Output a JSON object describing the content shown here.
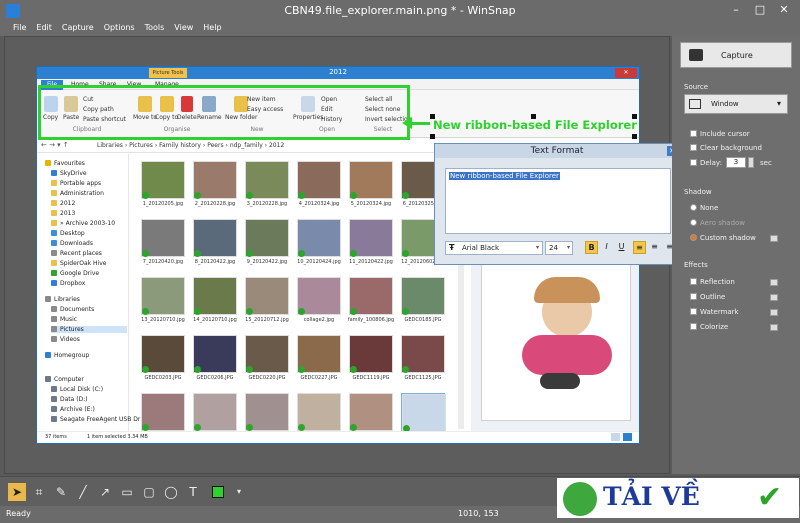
{
  "app": {
    "title": "CBN49.file_explorer.main.png * - WinSnap",
    "window_buttons": [
      "–",
      "□",
      "✕"
    ],
    "menu": [
      "File",
      "Edit",
      "Capture",
      "Options",
      "Tools",
      "View",
      "Help"
    ]
  },
  "explorer": {
    "title": "2012",
    "context_tab": "Picture Tools",
    "tabs": [
      "File",
      "Home",
      "Share",
      "View",
      "Manage"
    ],
    "ribbon": {
      "clipboard": {
        "copy": "Copy",
        "paste": "Paste",
        "cut": "Cut",
        "copy_path": "Copy path",
        "paste_shortcut": "Paste shortcut",
        "label": "Clipboard"
      },
      "organise": {
        "move_to": "Move to",
        "copy_to": "Copy to",
        "delete": "Delete",
        "rename": "Rename",
        "label": "Organise"
      },
      "new": {
        "new_folder": "New folder",
        "new_item": "New item",
        "easy_access": "Easy access",
        "label": "New"
      },
      "open": {
        "properties": "Properties",
        "open": "Open",
        "edit": "Edit",
        "history": "History",
        "label": "Open"
      },
      "select": {
        "select_all": "Select all",
        "select_none": "Select none",
        "invert": "Invert selection",
        "label": "Select"
      }
    },
    "breadcrumb": [
      "Libraries",
      "Pictures",
      "Family history",
      "Peers",
      "ndp_family",
      "2012"
    ],
    "nav": [
      {
        "label": "Favourites",
        "color": "#e6b400"
      },
      {
        "label": "SkyDrive",
        "color": "#2f7ed8"
      },
      {
        "label": "Portable apps",
        "color": "#e8c04a"
      },
      {
        "label": "Administration",
        "color": "#e8c04a"
      },
      {
        "label": "2012",
        "color": "#e8c04a"
      },
      {
        "label": "2013",
        "color": "#e8c04a"
      },
      {
        "label": "» Archive 2003-10",
        "color": "#e8c04a"
      },
      {
        "label": "Desktop",
        "color": "#3a8fd8"
      },
      {
        "label": "Downloads",
        "color": "#3a8fd8"
      },
      {
        "label": "Recent places",
        "color": "#8a8a8a"
      },
      {
        "label": "SpiderOak Hive",
        "color": "#e8c04a"
      },
      {
        "label": "Google Drive",
        "color": "#2da52d"
      },
      {
        "label": "Dropbox",
        "color": "#2f7ed8"
      },
      {
        "label": "Libraries",
        "color": "#8a8a8a"
      },
      {
        "label": "Documents",
        "color": "#8a8a8a"
      },
      {
        "label": "Music",
        "color": "#8a8a8a"
      },
      {
        "label": "Pictures",
        "color": "#8a8a8a"
      },
      {
        "label": "Videos",
        "color": "#8a8a8a"
      },
      {
        "label": "Homegroup",
        "color": "#2f7ed8"
      },
      {
        "label": "Computer",
        "color": "#6a7a8a"
      },
      {
        "label": "Local Disk (C:)",
        "color": "#6a7a8a"
      },
      {
        "label": "Data (D:)",
        "color": "#6a7a8a"
      },
      {
        "label": "Archive (E:)",
        "color": "#6a7a8a"
      },
      {
        "label": "Seagate FreeAgent USB Dr",
        "color": "#6a7a8a"
      }
    ],
    "thumbnails": [
      {
        "name": "1_20120205.jpg",
        "color": "#6f8a4a"
      },
      {
        "name": "2_20120228.jpg",
        "color": "#9a7a6a"
      },
      {
        "name": "3_20120228.jpg",
        "color": "#7a8a5a"
      },
      {
        "name": "4_20120324.jpg",
        "color": "#8a6a5a"
      },
      {
        "name": "5_20120324.jpg",
        "color": "#a07a5a"
      },
      {
        "name": "6_20120325.jpg",
        "color": "#6a5a4a"
      },
      {
        "name": "7_20120420.jpg",
        "color": "#7a7a7a"
      },
      {
        "name": "8_20120422.jpg",
        "color": "#5a6a7a"
      },
      {
        "name": "9_20120422.jpg",
        "color": "#6a7a5a"
      },
      {
        "name": "10_20120424.jpg",
        "color": "#7a8aaa"
      },
      {
        "name": "11_20120422.jpg",
        "color": "#8a7a9a"
      },
      {
        "name": "12_20120602.jpg",
        "color": "#7a9a6a"
      },
      {
        "name": "13_20120710.jpg",
        "color": "#8a9a7a"
      },
      {
        "name": "14_20120710.jpg",
        "color": "#6a7a4a"
      },
      {
        "name": "15_20120712.jpg",
        "color": "#9a8a7a"
      },
      {
        "name": "collage2.jpg",
        "color": "#aa8a9a"
      },
      {
        "name": "family_100806.jpg",
        "color": "#9a6a6a"
      },
      {
        "name": "GEDC0185.JPG",
        "color": "#6a8a6a"
      },
      {
        "name": "GEDC0203.JPG",
        "color": "#5a4a3a"
      },
      {
        "name": "GEDC0206.JPG",
        "color": "#3a3a5a"
      },
      {
        "name": "GEDC0220.JPG",
        "color": "#6a5a4a"
      },
      {
        "name": "GEDC0227.JPG",
        "color": "#8a6a4a"
      },
      {
        "name": "GEDC1119.JPG",
        "color": "#6a3a3a"
      },
      {
        "name": "GEDC1125.JPG",
        "color": "#7a4a4a"
      },
      {
        "name": "",
        "color": "#9a7a7a"
      },
      {
        "name": "",
        "color": "#b0a0a0"
      },
      {
        "name": "",
        "color": "#a09090"
      },
      {
        "name": "",
        "color": "#c0b0a0"
      },
      {
        "name": "",
        "color": "#b09080"
      },
      {
        "name": "",
        "color": "#c8d8e8"
      }
    ],
    "status_items": "37 items",
    "status_selected": "1 item selected  3.34 MB"
  },
  "callout": "New ribbon-based File Explorer",
  "text_format": {
    "title": "Text Format",
    "text": "New ribbon-based File Explorer",
    "font": "Arial Black",
    "size": "24",
    "bold": "B",
    "italic": "I",
    "underline": "U",
    "font_icon": "Ŧ"
  },
  "side": {
    "capture_button": "Capture",
    "source_label": "Source",
    "source_value": "Window",
    "include_cursor": "Include cursor",
    "clear_background": "Clear background",
    "delay_label": "Delay:",
    "delay_value": "3",
    "delay_unit": "sec",
    "shadow_label": "Shadow",
    "shadow_none": "None",
    "shadow_aero": "Aero shadow",
    "shadow_custom": "Custom shadow",
    "effects_label": "Effects",
    "effect_reflection": "Reflection",
    "effect_outline": "Outline",
    "effect_watermark": "Watermark",
    "effect_colorize": "Colorize"
  },
  "status": {
    "left": "Ready",
    "coords": "1010, 153"
  },
  "watermark": {
    "text": "TẢI VỀ"
  },
  "colors": {
    "accent_green": "#2ed12e",
    "explorer_blue": "#2d7fd0"
  }
}
